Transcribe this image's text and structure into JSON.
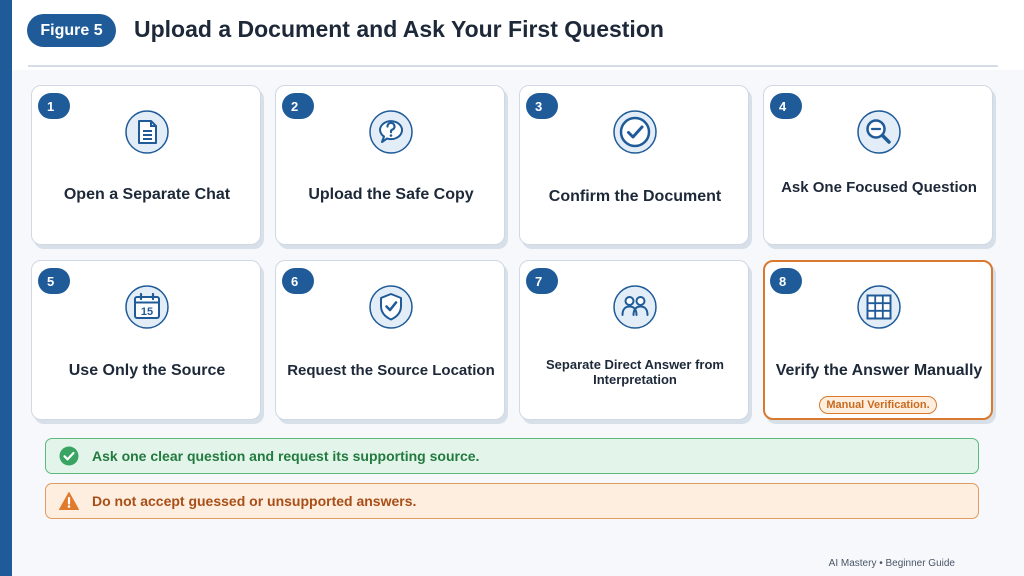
{
  "header": {
    "figure_label": "Figure 5",
    "title": "Upload a Document and Ask Your First Question"
  },
  "steps": [
    {
      "number": "1",
      "title": "Open a Separate Chat",
      "icon": "document-icon"
    },
    {
      "number": "2",
      "title": "Upload the Safe Copy",
      "icon": "question-bubble-icon"
    },
    {
      "number": "3",
      "title": "Confirm the Document",
      "icon": "checkmark-circle-icon"
    },
    {
      "number": "4",
      "title": "Ask One Focused Question",
      "icon": "magnifier-icon"
    },
    {
      "number": "5",
      "title": "Use Only the Source",
      "icon": "calendar-icon",
      "icon_text": "15"
    },
    {
      "number": "6",
      "title": "Request the Source Location",
      "icon": "shield-check-icon"
    },
    {
      "number": "7",
      "title": "Separate Direct Answer from Interpretation",
      "icon": "people-icon"
    },
    {
      "number": "8",
      "title": "Verify the Answer Manually",
      "icon": "grid-icon",
      "badge": "Manual Verification."
    }
  ],
  "banners": {
    "tip": "Ask one clear question and request its supporting source.",
    "warning": "Do not accept guessed or unsupported answers."
  },
  "footer": "AI Mastery • Beginner Guide",
  "colors": {
    "primary": "#1f5b98",
    "accent_orange": "#d8792f",
    "success": "#3aa562",
    "warning": "#e07a2c"
  }
}
